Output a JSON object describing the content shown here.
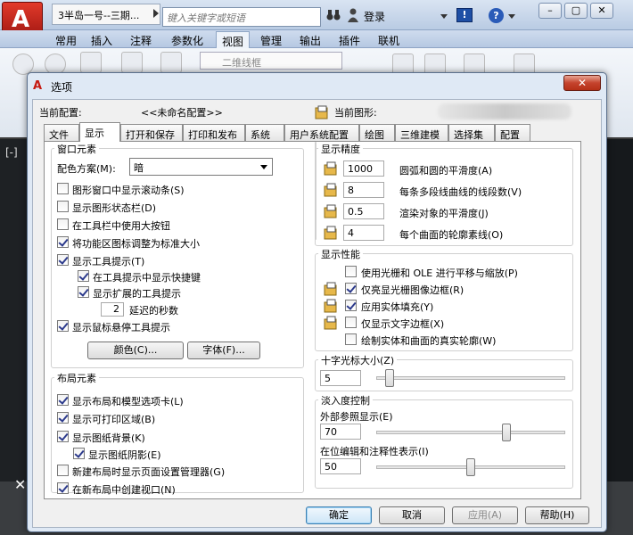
{
  "app": {
    "doc_title": "3半岛一号--三期...",
    "search_placeholder": "键入关键字或短语",
    "login": "登录",
    "ribbon_tabs": [
      "常用",
      "插入",
      "注释",
      "参数化",
      "视图",
      "管理",
      "输出",
      "插件",
      "联机"
    ],
    "active_ribbon_tab": "视图",
    "visual_style": "二维线框",
    "left_label": "[-]",
    "close_x": "✕",
    "window_buttons": [
      "–",
      "▢",
      "✕"
    ]
  },
  "dialog": {
    "title": "选项",
    "close_label": "✕",
    "current_profile_label": "当前配置:",
    "current_profile_value": "<<未命名配置>>",
    "current_drawing_label": "当前图形:",
    "tabs": [
      "文件",
      "显示",
      "打开和保存",
      "打印和发布",
      "系统",
      "用户系统配置",
      "绘图",
      "三维建模",
      "选择集",
      "配置"
    ],
    "active_tab": "显示",
    "window_elements": {
      "title": "窗口元素",
      "color_scheme_label": "配色方案(M):",
      "color_scheme_value": "暗",
      "options": [
        {
          "label": "图形窗口中显示滚动条(S)",
          "checked": false
        },
        {
          "label": "显示图形状态栏(D)",
          "checked": false
        },
        {
          "label": "在工具栏中使用大按钮",
          "checked": false
        },
        {
          "label": "将功能区图标调整为标准大小",
          "checked": true
        },
        {
          "label": "显示工具提示(T)",
          "checked": true
        },
        {
          "label": "在工具提示中显示快捷键",
          "checked": true
        },
        {
          "label": "显示扩展的工具提示",
          "checked": true
        },
        {
          "label": "显示鼠标悬停工具提示",
          "checked": true
        }
      ],
      "delay_value": "2",
      "delay_label": "延迟的秒数",
      "colors_button": "颜色(C)...",
      "fonts_button": "字体(F)..."
    },
    "layout_elements": {
      "title": "布局元素",
      "options": [
        {
          "label": "显示布局和模型选项卡(L)",
          "checked": true
        },
        {
          "label": "显示可打印区域(B)",
          "checked": true
        },
        {
          "label": "显示图纸背景(K)",
          "checked": true
        },
        {
          "label": "显示图纸阴影(E)",
          "checked": true
        },
        {
          "label": "新建布局时显示页面设置管理器(G)",
          "checked": false
        },
        {
          "label": "在新布局中创建视口(N)",
          "checked": true
        }
      ]
    },
    "display_resolution": {
      "title": "显示精度",
      "items": [
        {
          "value": "1000",
          "label": "圆弧和圆的平滑度(A)"
        },
        {
          "value": "8",
          "label": "每条多段线曲线的线段数(V)"
        },
        {
          "value": "0.5",
          "label": "渲染对象的平滑度(J)"
        },
        {
          "value": "4",
          "label": "每个曲面的轮廓素线(O)"
        }
      ]
    },
    "display_performance": {
      "title": "显示性能",
      "items": [
        {
          "label": "使用光栅和 OLE 进行平移与缩放(P)",
          "checked": false,
          "icon": false
        },
        {
          "label": "仅亮显光栅图像边框(R)",
          "checked": true,
          "icon": true
        },
        {
          "label": "应用实体填充(Y)",
          "checked": true,
          "icon": true
        },
        {
          "label": "仅显示文字边框(X)",
          "checked": false,
          "icon": true
        },
        {
          "label": "绘制实体和曲面的真实轮廓(W)",
          "checked": false,
          "icon": false
        }
      ]
    },
    "crosshair": {
      "title": "十字光标大小(Z)",
      "value": "5",
      "level_fraction": 0.05
    },
    "fade_control": {
      "title": "淡入度控制",
      "xref_label": "外部参照显示(E)",
      "xref_value": "70",
      "xref_level_fraction": 0.7,
      "inplace_label": "在位编辑和注释性表示(I)",
      "inplace_value": "50",
      "inplace_level_fraction": 0.5
    },
    "buttons": {
      "ok": "确定",
      "cancel": "取消",
      "apply": "应用(A)",
      "help": "帮助(H)"
    }
  }
}
